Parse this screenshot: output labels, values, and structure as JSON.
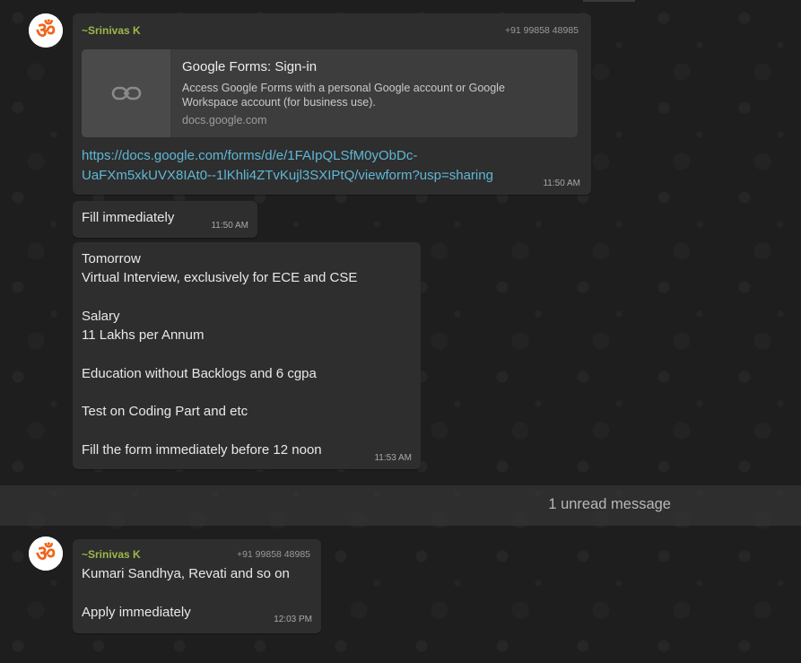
{
  "colors": {
    "sender": "#9cb84a",
    "link": "#5fb7d6",
    "bubble": "#2e2e2e",
    "background": "#1e1e1e"
  },
  "messages": [
    {
      "avatar_icon": "om-icon",
      "sender": "~Srinivas K",
      "phone": "+91 99858 48985",
      "link_preview": {
        "icon": "link-icon",
        "title": "Google Forms: Sign-in",
        "description": "Access Google Forms with a personal Google account or Google Workspace account (for business use).",
        "domain": "docs.google.com"
      },
      "link_line1": "https://docs.google.com/forms/d/e/1FAIpQLSfM0yObDc-",
      "link_line2": "UaFXm5xkUVX8IAt0--1lKhli4ZTvKujl3SXIPtQ/viewform?usp=sharing",
      "time": "11:50 AM"
    },
    {
      "text": "Fill immediately",
      "time": "11:50 AM"
    },
    {
      "text": "Tomorrow\nVirtual Interview, exclusively for ECE and CSE\n\nSalary\n11 Lakhs per Annum\n\nEducation without Backlogs and 6 cgpa\n\nTest on Coding Part and etc\n\nFill the form immediately before 12 noon",
      "time": "11:53 AM"
    },
    {
      "avatar_icon": "om-icon",
      "sender": "~Srinivas K",
      "phone": "+91 99858 48985",
      "text": "Kumari Sandhya, Revati and so on\n\nApply immediately",
      "time": "12:03 PM"
    }
  ],
  "unread_divider": "1 unread message"
}
